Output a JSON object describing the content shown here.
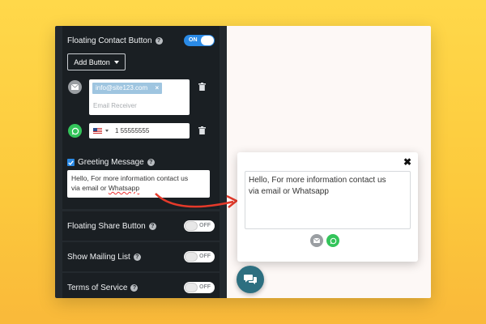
{
  "settings": {
    "floating_contact": {
      "label": "Floating Contact Button",
      "toggle": "ON"
    },
    "add_button_label": "Add Button",
    "email": {
      "value": "info@site123.com",
      "placeholder": "Email Receiver"
    },
    "phone": {
      "country": "US",
      "value": "1 55555555"
    },
    "greeting": {
      "label": "Greeting Message",
      "checked": true,
      "text_1": "Hello, For more information contact us",
      "text_2_pre": "via email or ",
      "text_2_word": "Whatsapp"
    },
    "floating_share": {
      "label": "Floating Share Button",
      "toggle": "OFF"
    },
    "mailing_list": {
      "label": "Show Mailing List",
      "toggle": "OFF"
    },
    "terms": {
      "label": "Terms of Service",
      "toggle": "OFF"
    }
  },
  "preview": {
    "close": "✖",
    "message_1": "Hello, For more information contact us",
    "message_2": "via email or Whatsapp"
  },
  "icons": [
    "help-icon",
    "mail-icon",
    "whatsapp-icon",
    "trash-icon",
    "us-flag-icon",
    "chat-icon",
    "close-icon",
    "arrow-icon"
  ],
  "colors": {
    "accent": "#2a8ae6",
    "whatsapp": "#33c45a",
    "chat": "#2d6f80",
    "panel": "#1a1f23",
    "background": "#fcc93c"
  }
}
